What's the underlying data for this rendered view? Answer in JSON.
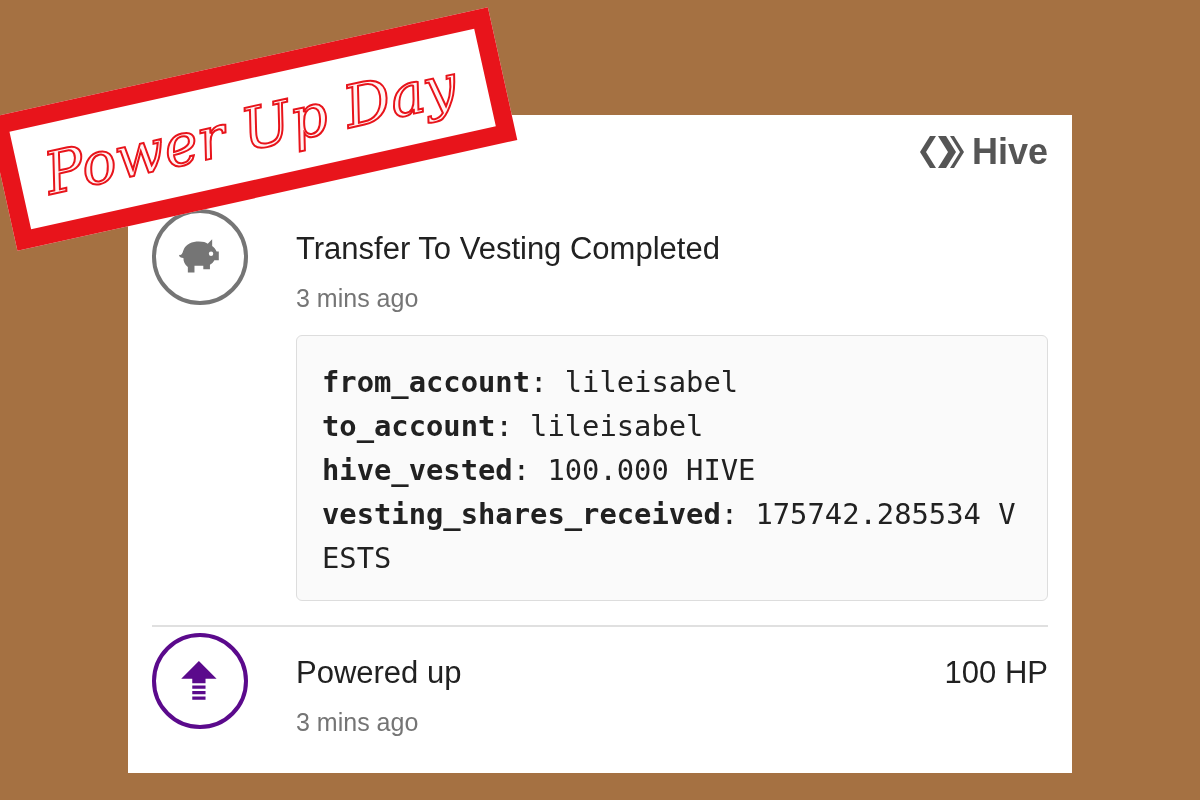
{
  "banner": {
    "text": "Power Up Day"
  },
  "brand": {
    "name": "Hive"
  },
  "items": [
    {
      "kind": "vesting",
      "title": "Transfer To Vesting Completed",
      "time": "3 mins ago",
      "details": [
        "**from_account**: lileisabel",
        "**to_account**: lileisabel",
        "**hive_vested**: 100.000 HIVE",
        "**vesting_shares_received**: 175742.285534 VESTS"
      ]
    },
    {
      "kind": "power_up",
      "title": "Powered up",
      "time": "3 mins ago",
      "amount": "100 HP"
    }
  ]
}
